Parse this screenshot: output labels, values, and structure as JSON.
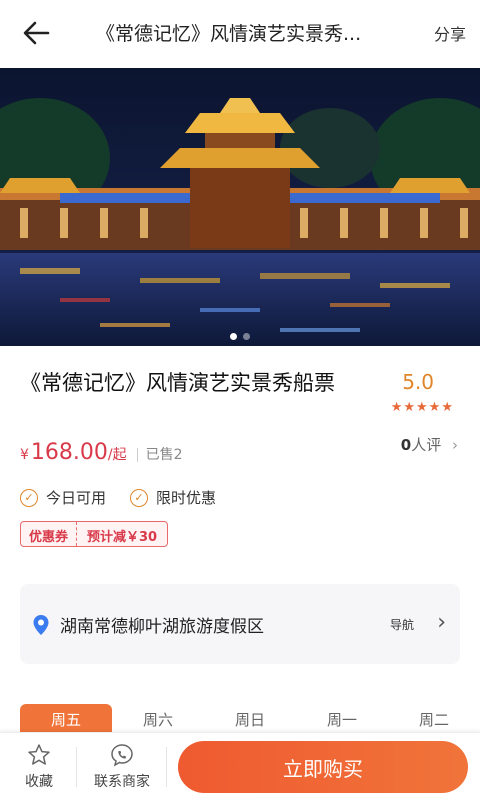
{
  "header": {
    "title": "《常德记忆》风情演艺实景秀...",
    "share_label": "分享"
  },
  "banner": {
    "slide_count": 2,
    "active_slide": 0
  },
  "product": {
    "title": "《常德记忆》风情演艺实景秀船票",
    "rating_score": "5.0",
    "rating_stars": "★★★★★",
    "review_count": "0",
    "review_suffix": "人评",
    "review_chevron": "›",
    "price_currency": "¥",
    "price_value": "168.00",
    "price_suffix": "/起",
    "sold_label": "已售2"
  },
  "tags": [
    {
      "label": "今日可用"
    },
    {
      "label": "限时优惠"
    }
  ],
  "coupon": {
    "label": "优惠券",
    "discount": "预计减￥30"
  },
  "location": {
    "address": "湖南常德柳叶湖旅游度假区",
    "nav_label": "导航",
    "chevron": "›"
  },
  "day_tabs": [
    "周五",
    "周六",
    "周日",
    "周一",
    "周二"
  ],
  "bottom_bar": {
    "favorite_label": "收藏",
    "contact_label": "联系商家",
    "buy_label": "立即购买"
  },
  "colors": {
    "accent": "#f0743a",
    "price": "#d93a4a",
    "rating": "#e0862a",
    "pin": "#3b7cf0"
  }
}
